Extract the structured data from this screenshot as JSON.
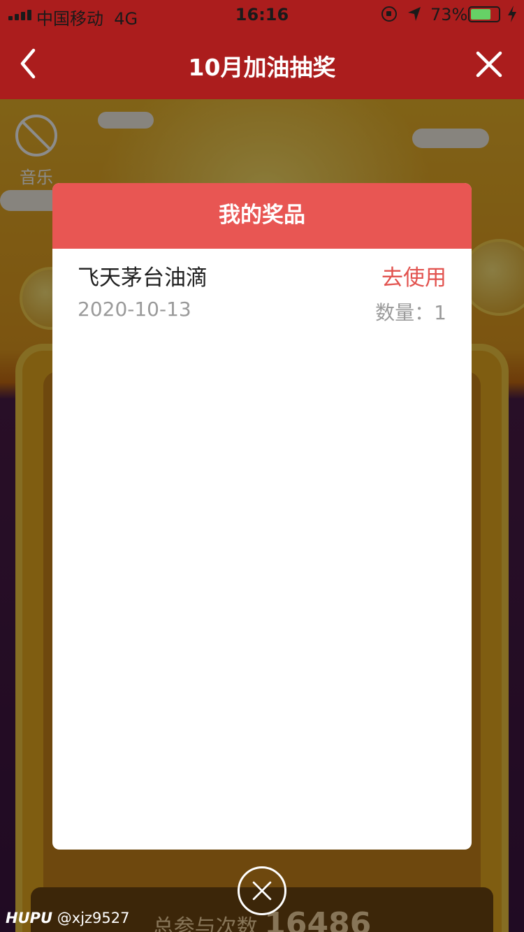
{
  "status_bar": {
    "carrier": "中国移动",
    "network": "4G",
    "time": "16:16",
    "battery_percent": "73%",
    "battery_level": 0.73,
    "battery_color": "#66d166"
  },
  "nav": {
    "title": "10月加油抽奖",
    "back_icon": "chevron-left-icon",
    "close_icon": "close-icon"
  },
  "background": {
    "music_label": "音乐",
    "participation_label": "总参与次数",
    "participation_count": "16486"
  },
  "dialog": {
    "title": "我的奖品",
    "header_color": "#e85653",
    "prizes": [
      {
        "name": "飞天茅台油滴",
        "action": "去使用",
        "date": "2020-10-13",
        "quantity_label": "数量：1"
      }
    ]
  },
  "watermark": {
    "brand": "HUPU",
    "user": "@xjz9527"
  }
}
